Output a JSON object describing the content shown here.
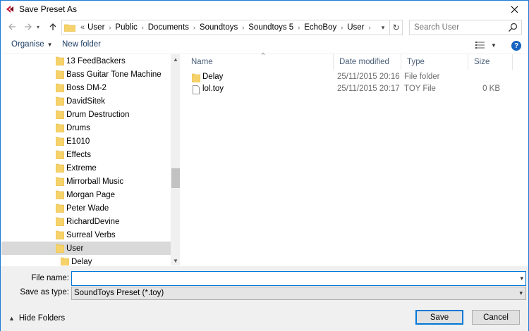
{
  "window": {
    "title": "Save Preset As",
    "accent_color": "#1c7ad4"
  },
  "address": {
    "overflow_indicator": "«",
    "crumbs": [
      "User",
      "Public",
      "Documents",
      "Soundtoys",
      "Soundtoys 5",
      "EchoBoy",
      "User"
    ],
    "search_placeholder": "Search User"
  },
  "toolbar": {
    "organise_label": "Organise",
    "new_folder_label": "New folder",
    "help_label": "?"
  },
  "tree": {
    "items": [
      {
        "label": "13 FeedBackers",
        "indent": 0,
        "selected": false
      },
      {
        "label": "Bass Guitar Tone Machine",
        "indent": 0,
        "selected": false
      },
      {
        "label": "Boss DM-2",
        "indent": 0,
        "selected": false
      },
      {
        "label": "DavidSitek",
        "indent": 0,
        "selected": false
      },
      {
        "label": "Drum Destruction",
        "indent": 0,
        "selected": false
      },
      {
        "label": "Drums",
        "indent": 0,
        "selected": false
      },
      {
        "label": "E1010",
        "indent": 0,
        "selected": false
      },
      {
        "label": "Effects",
        "indent": 0,
        "selected": false
      },
      {
        "label": "Extreme",
        "indent": 0,
        "selected": false
      },
      {
        "label": "Mirrorball Music",
        "indent": 0,
        "selected": false
      },
      {
        "label": "Morgan Page",
        "indent": 0,
        "selected": false
      },
      {
        "label": "Peter Wade",
        "indent": 0,
        "selected": false
      },
      {
        "label": "RichardDevine",
        "indent": 0,
        "selected": false
      },
      {
        "label": "Surreal Verbs",
        "indent": 0,
        "selected": false
      },
      {
        "label": "User",
        "indent": 0,
        "selected": true
      },
      {
        "label": "Delay",
        "indent": 1,
        "selected": false
      }
    ],
    "selected_color": "#d9d9d9"
  },
  "list": {
    "columns": {
      "name": "Name",
      "date": "Date modified",
      "type": "Type",
      "size": "Size"
    },
    "rows": [
      {
        "name": "Delay",
        "date": "25/11/2015 20:16",
        "type": "File folder",
        "size": "",
        "icon": "folder-icon"
      },
      {
        "name": "lol.toy",
        "date": "25/11/2015 20:17",
        "type": "TOY File",
        "size": "0 KB",
        "icon": "file-icon"
      }
    ]
  },
  "form": {
    "file_name_label": "File name:",
    "file_name_value": "",
    "save_as_type_label": "Save as type:",
    "save_as_type_value": "SoundToys Preset (*.toy)"
  },
  "footer": {
    "hide_folders_label": "Hide Folders",
    "save_label": "Save",
    "cancel_label": "Cancel"
  },
  "colors": {
    "folder": "#f6d26b",
    "folder_dark": "#e0b23c",
    "help": "#1464c0",
    "focus_border": "#0078d7"
  }
}
